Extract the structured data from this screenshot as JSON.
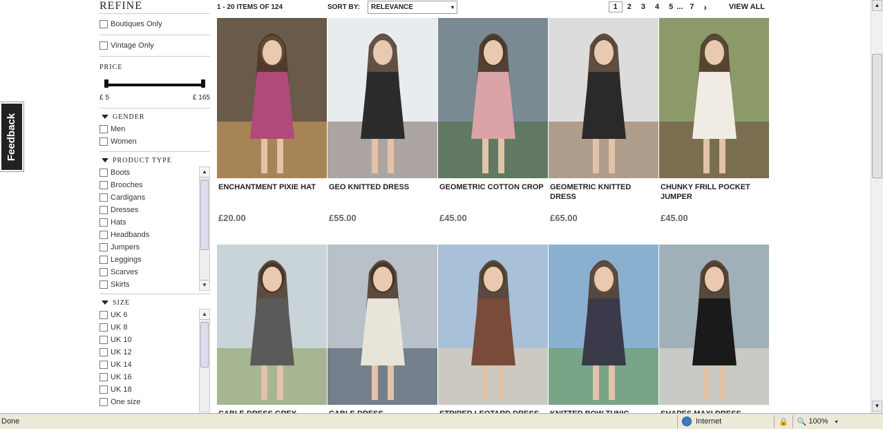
{
  "feedback": {
    "label": "Feedback"
  },
  "sidebar": {
    "title": "REFINE",
    "filters": [
      "Boutiques Only",
      "Vintage Only"
    ],
    "price": {
      "title": "PRICE",
      "min_label": "£ 5",
      "max_label": "£ 165",
      "range": [
        5,
        165
      ]
    },
    "gender": {
      "title": "GENDER",
      "options": [
        "Men",
        "Women"
      ]
    },
    "product_type": {
      "title": "PRODUCT TYPE",
      "options": [
        "Boots",
        "Brooches",
        "Cardigans",
        "Dresses",
        "Hats",
        "Headbands",
        "Jumpers",
        "Leggings",
        "Scarves",
        "Skirts"
      ]
    },
    "size": {
      "title": "SIZE",
      "options": [
        "UK 6",
        "UK 8",
        "UK 10",
        "UK 12",
        "UK 14",
        "UK 16",
        "UK 18",
        "One size"
      ]
    }
  },
  "toolbar": {
    "items_count": "1 - 20 ITEMS OF 124",
    "sort_label": "SORT BY:",
    "sort_value": "RELEVANCE",
    "pages": [
      "1",
      "2",
      "3",
      "4",
      "5",
      "...",
      "7"
    ],
    "current_page": "1",
    "next": "›",
    "view_all": "VIEW ALL"
  },
  "products": [
    {
      "name": "ENCHANTMENT PIXIE HAT",
      "price": "£20.00",
      "colors": {
        "bg": "#6a5a4a",
        "a": "#b04a78",
        "b": "#d9a860",
        "c": "#e8c0a0"
      }
    },
    {
      "name": "GEO KNITTED DRESS",
      "price": "£55.00",
      "colors": {
        "bg": "#e9ecef",
        "a": "#2b2b2b",
        "b": "#7a6a60",
        "c": "#ffffff"
      }
    },
    {
      "name": "GEOMETRIC COTTON CROP",
      "price": "£45.00",
      "colors": {
        "bg": "#7a8a92",
        "a": "#d9a3a8",
        "b": "#4d6a3a",
        "c": "#555555"
      }
    },
    {
      "name": "GEOMETRIC KNITTED DRESS",
      "price": "£65.00",
      "colors": {
        "bg": "#dcdcdc",
        "a": "#2a2a2a",
        "b": "#8a6a4a",
        "c": "#b9b0a0"
      }
    },
    {
      "name": "CHUNKY FRILL POCKET JUMPER",
      "price": "£45.00",
      "colors": {
        "bg": "#8c9a6a",
        "a": "#f0ece4",
        "b": "#6a4a3a",
        "c": "#a8b890"
      }
    },
    {
      "name": "CABLE DRESS GREY",
      "price": "",
      "colors": {
        "bg": "#c8d4d8",
        "a": "#5a5a5a",
        "b": "#8a9a5a",
        "c": "#4a3a2a"
      }
    },
    {
      "name": "CABLE DRESS",
      "price": "",
      "colors": {
        "bg": "#b8c0c8",
        "a": "#e8e4da",
        "b": "#3a4a5a",
        "c": "#4a3a2a"
      }
    },
    {
      "name": "STRIPED LEOTARD DRESS",
      "price": "",
      "colors": {
        "bg": "#a8c0d8",
        "a": "#7a4a3a",
        "b": "#e8d0b0",
        "c": "#6a8a4a"
      }
    },
    {
      "name": "KNITTED BOW TUNIC",
      "price": "",
      "colors": {
        "bg": "#8ab0d0",
        "a": "#3a3a4a",
        "b": "#6a9a4a",
        "c": "#d8d0c0"
      }
    },
    {
      "name": "SHAPES MAXI DRESS",
      "price": "",
      "colors": {
        "bg": "#a0b0b8",
        "a": "#1a1a1a",
        "b": "#e8e0d0",
        "c": "#6a7a4a"
      }
    }
  ],
  "statusbar": {
    "left": "Done",
    "zone": "Internet",
    "zoom": "100%"
  }
}
